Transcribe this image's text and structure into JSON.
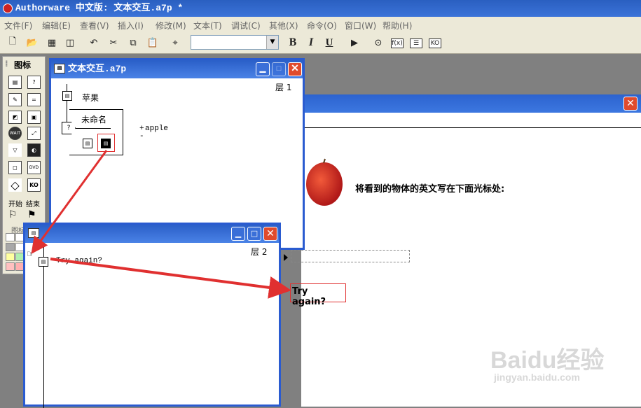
{
  "app": {
    "title": "Authorware 中文版: 文本交互.a7p *"
  },
  "menu": [
    "文件(F)",
    "编辑(E)",
    "查看(V)",
    "插入(I)",
    "修改(M)",
    "文本(T)",
    "调试(C)",
    "其他(X)",
    "命令(O)",
    "窗口(W)",
    "帮助(H)"
  ],
  "toolbar": {
    "font_combo_value": "",
    "bold": "B",
    "italic": "I",
    "underline": "U",
    "fn_label": "f(x)",
    "ko_label": "KO"
  },
  "palette": {
    "title": "图标",
    "start_label": "开始",
    "end_label": "结束",
    "color_label": "图标",
    "icons": [
      "display",
      "interaction",
      "calculation",
      "navigate",
      "erase",
      "framework",
      "wait",
      "decision",
      "motion",
      "digital-movie",
      "map",
      "video",
      "sound",
      "knowledge-object"
    ],
    "icon_glyphs": {
      "wait": "WAIT",
      "video": "DVD",
      "knowledge-object": "KO"
    },
    "swatches": [
      "#ffffff",
      "#ffffff",
      "#a8a8a8",
      "#ffffff",
      "#ffffa0",
      "#b0f0b0",
      "#ffc0c0",
      "#ffb0b0",
      "#a0c8ff",
      "#40d0ff"
    ]
  },
  "window1": {
    "title": "文本交互.a7p",
    "level": "层 1",
    "icon_apple": "苹果",
    "interaction_name": "未命名",
    "response_label": "apple",
    "response_prefix_plus": "+",
    "response_prefix_minus": "-"
  },
  "window2": {
    "level": "层 2",
    "feedback_text": "Try again?"
  },
  "presentation": {
    "prompt": "将看到的物体的英文写在下面光标处:",
    "feedback_text": "Try again?"
  },
  "watermark": {
    "brand": "Baidu经验",
    "url": "jingyan.baidu.com"
  },
  "colors": {
    "titlebar": "#2a5fc8",
    "arrow": "#e03030",
    "close": "#e04b2d"
  }
}
